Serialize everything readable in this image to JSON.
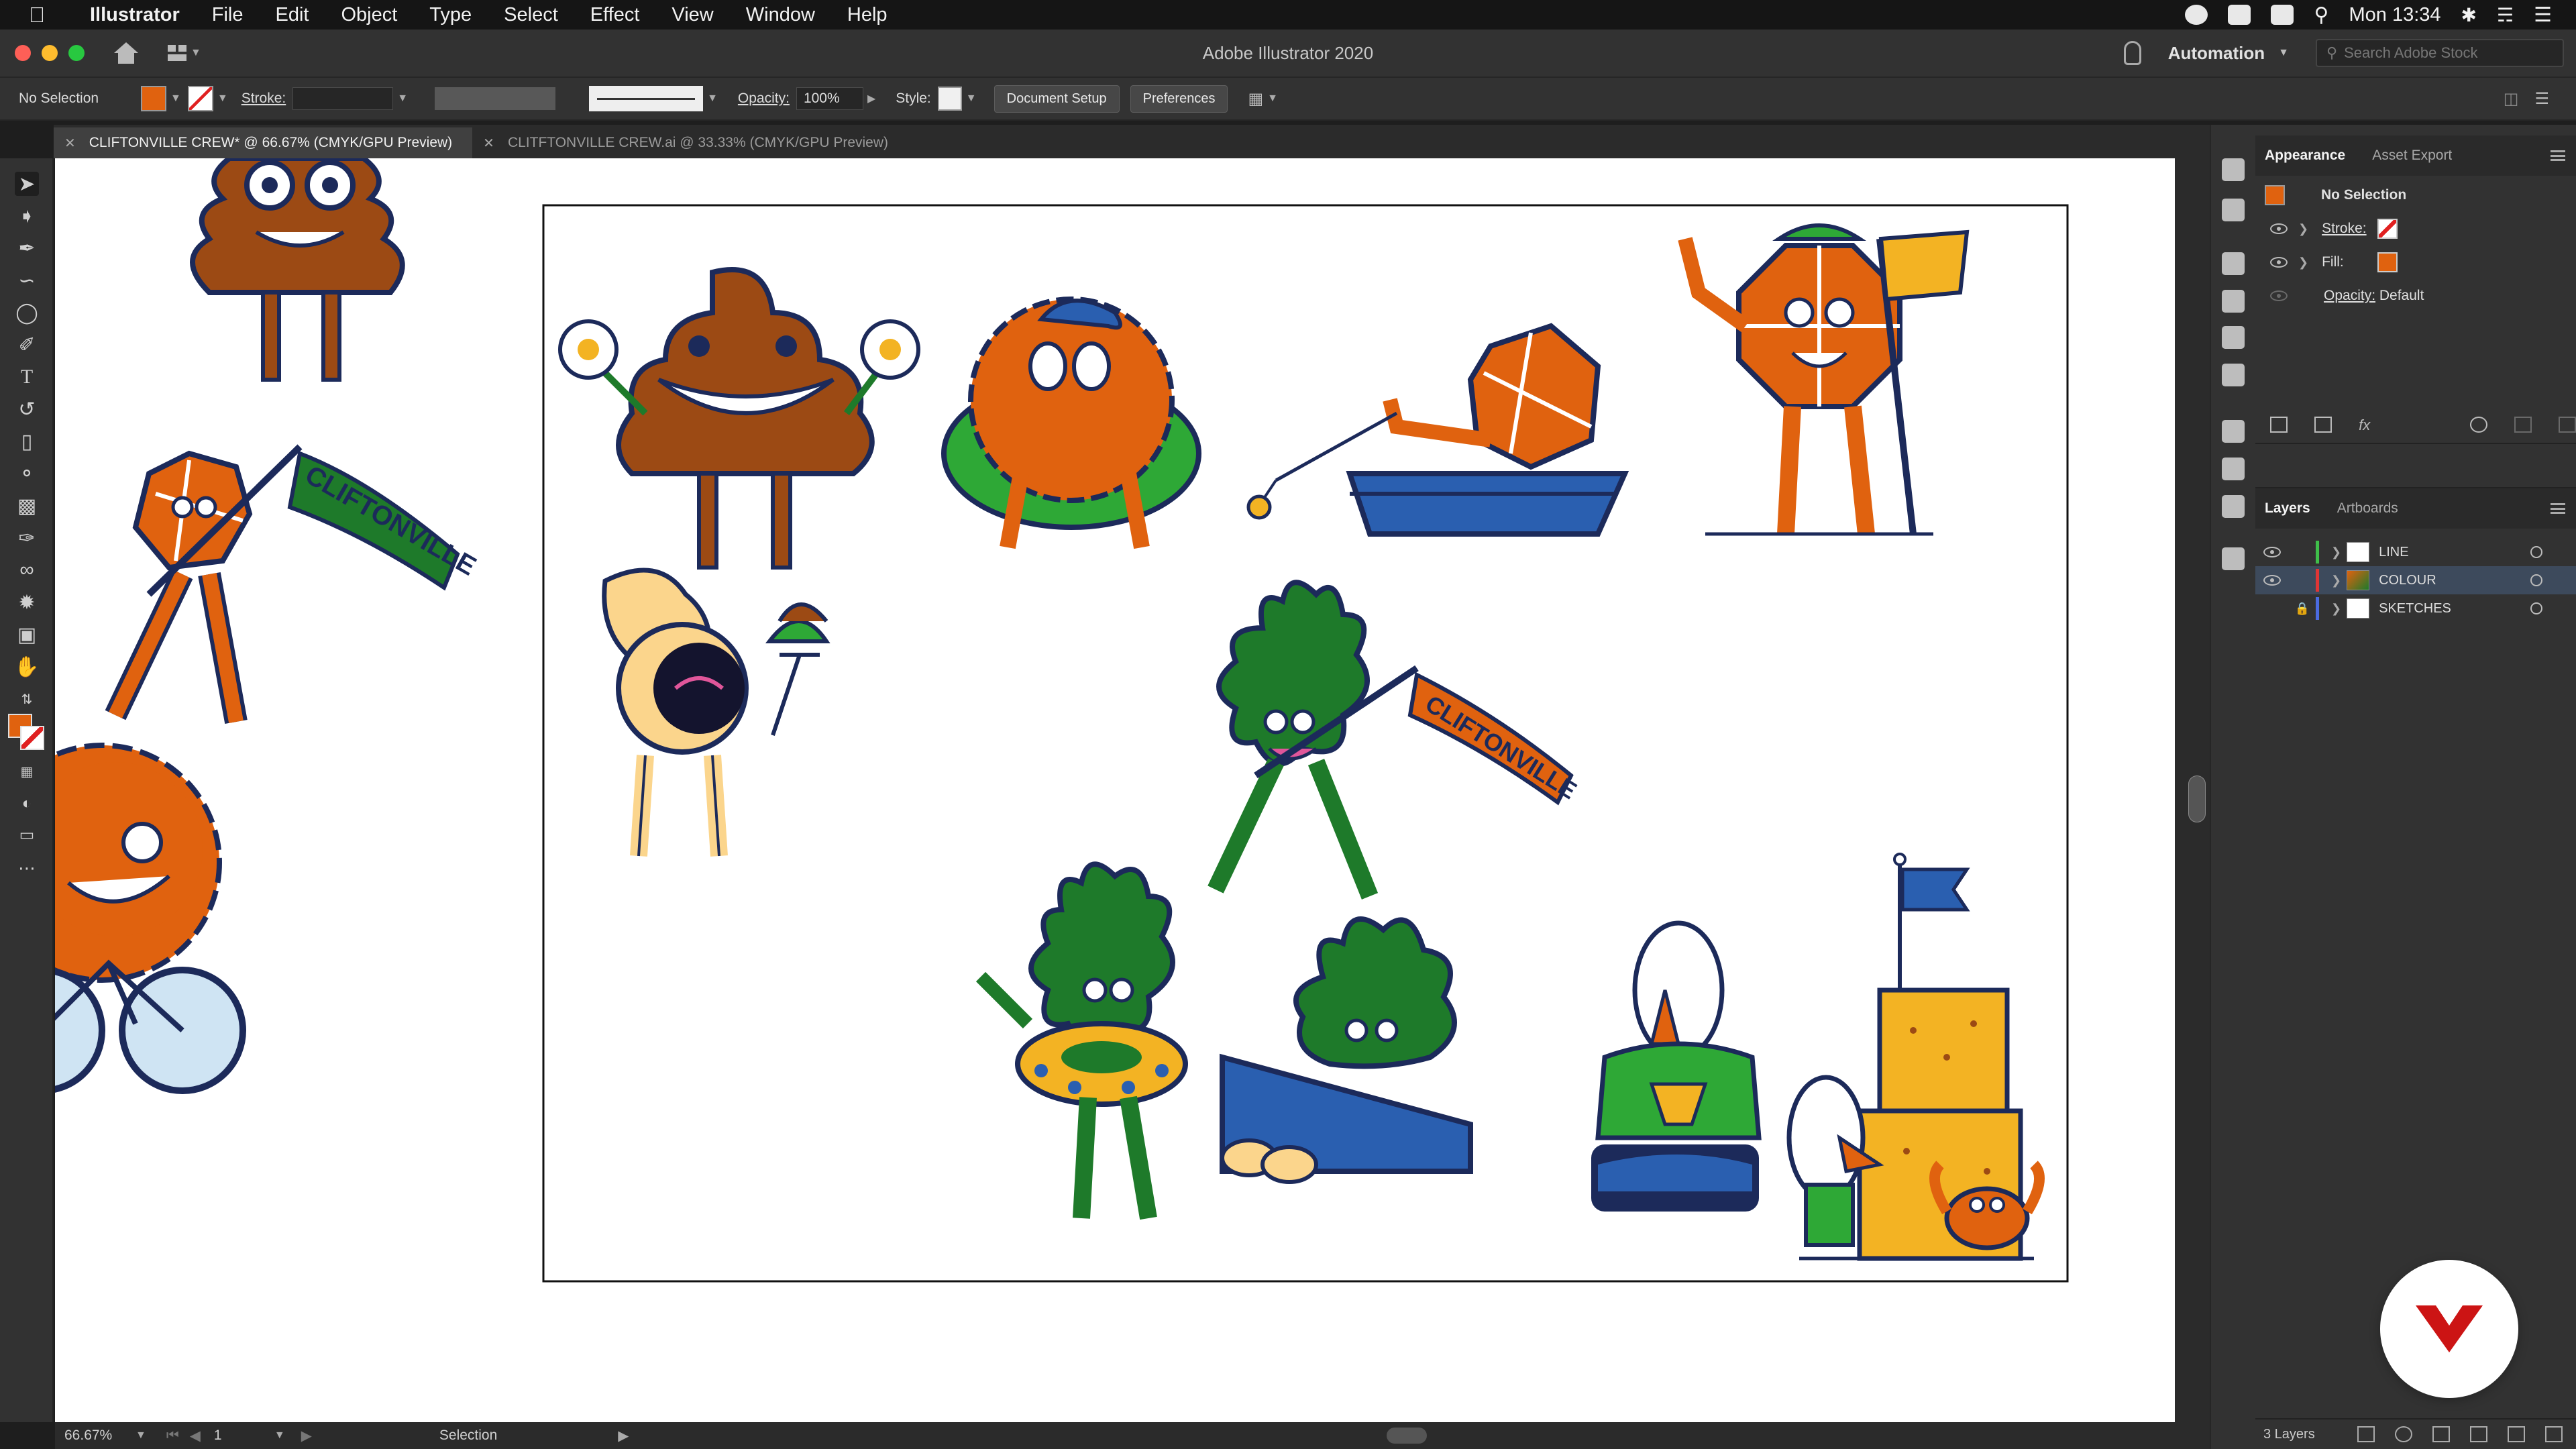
{
  "menubar": {
    "app_name": "Illustrator",
    "items": [
      "File",
      "Edit",
      "Object",
      "Type",
      "Select",
      "Effect",
      "View",
      "Window",
      "Help"
    ],
    "clock": "Mon 13:34"
  },
  "titlebar": {
    "title": "Adobe Illustrator 2020",
    "workspace": "Automation",
    "stock_placeholder": "Search Adobe Stock"
  },
  "controlbar": {
    "selection": "No Selection",
    "stroke_label": "Stroke:",
    "opacity_label": "Opacity:",
    "opacity_value": "100%",
    "style_label": "Style:",
    "document_setup": "Document Setup",
    "preferences": "Preferences",
    "fill_color": "#e0620f"
  },
  "tabs": [
    {
      "label": "CLIFTONVILLE CREW* @ 66.67% (CMYK/GPU Preview)",
      "active": true
    },
    {
      "label": "CLITFTONVILLE CREW.ai @ 33.33% (CMYK/GPU Preview)",
      "active": false
    }
  ],
  "tools": [
    "selection-tool",
    "direct-selection-tool",
    "pen-tool",
    "curvature-tool",
    "ellipse-tool",
    "paintbrush-tool",
    "type-tool",
    "rotate-tool",
    "eraser-tool",
    "shape-builder-tool",
    "gradient-tool",
    "eyedropper-tool",
    "blend-tool",
    "symbol-sprayer-tool",
    "artboard-tool",
    "hand-tool"
  ],
  "artwork": {
    "banner_text": "CLIFTONVILLE",
    "colors": {
      "orange": "#e0620f",
      "brown": "#9c4a14",
      "green": "#1e7a2a",
      "light_green": "#2ea836",
      "navy": "#1c2a5a",
      "blue": "#2a5fb0",
      "yellow": "#f3b323",
      "cream": "#fbd58c",
      "dark_navy": "#14142e"
    }
  },
  "statusbar": {
    "zoom": "66.67%",
    "artboard": "1",
    "tool": "Selection"
  },
  "appearance_panel": {
    "tabs": [
      "Appearance",
      "Asset Export"
    ],
    "header": "No Selection",
    "stroke_label": "Stroke:",
    "fill_label": "Fill:",
    "opacity_label": "Opacity:",
    "opacity_value": "Default"
  },
  "layers_panel": {
    "tabs": [
      "Layers",
      "Artboards"
    ],
    "layers": [
      {
        "name": "LINE",
        "color": "#3fbf4a"
      },
      {
        "name": "COLOUR",
        "color": "#e03535"
      },
      {
        "name": "SKETCHES",
        "color": "#4b6be0"
      }
    ],
    "count": "3 Layers"
  },
  "watermark_color": "#cc1414"
}
